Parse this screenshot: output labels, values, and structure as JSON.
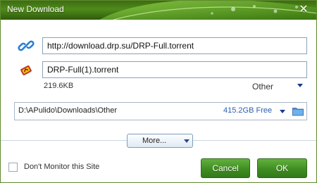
{
  "window": {
    "title": "New Download",
    "close_glyph": "✕"
  },
  "download": {
    "url": "http://download.drp.su/DRP-Full.torrent",
    "filename": "DRP-Full(1).torrent",
    "size": "219.6KB",
    "category": "Other"
  },
  "save": {
    "path": "D:\\APulido\\Downloads\\Other",
    "free_space": "415.2GB Free"
  },
  "more_button": {
    "label": "More..."
  },
  "footer": {
    "dont_monitor_label": "Don't Monitor this Site",
    "dont_monitor_checked": false,
    "cancel_label": "Cancel",
    "ok_label": "OK"
  },
  "colors": {
    "title_green": "#4f8b1a",
    "button_green": "#3f8d22",
    "link_blue": "#2a5fb0",
    "arrow_blue": "#1a3a8a"
  },
  "icons": {
    "link": "chain-link-icon",
    "torrent": "torrent-file-icon",
    "folder": "folder-icon",
    "close": "close-icon"
  }
}
